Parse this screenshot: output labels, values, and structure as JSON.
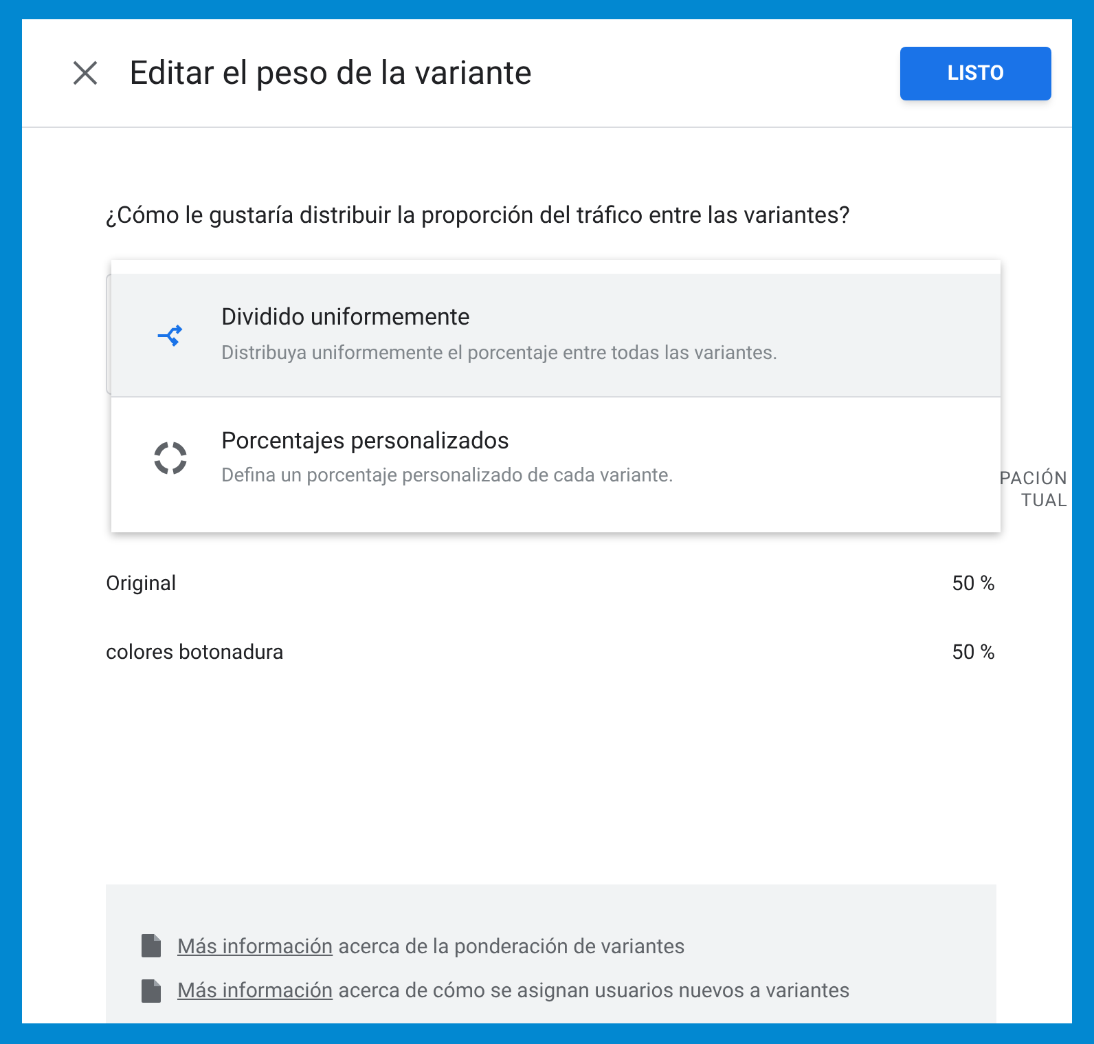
{
  "dialog": {
    "title": "Editar el peso de la variante",
    "done_button": "LISTO"
  },
  "question": "¿Cómo le gustaría distribuir la proporción del tráfico entre las variantes?",
  "menu": {
    "items": [
      {
        "kind": "split",
        "label": "Dividido uniformemente",
        "description": "Distribuya uniformemente el porcentaje entre todas las variantes.",
        "selected": true
      },
      {
        "kind": "custom",
        "label": "Porcentajes personalizados",
        "description": "Defina un porcentaje personalizado de cada variante.",
        "selected": false
      }
    ]
  },
  "table": {
    "columns": [
      "PACIÓN TUAL"
    ],
    "rows": [
      {
        "name": "Original",
        "share": "50 %"
      },
      {
        "name": "colores botonadura",
        "share": "50 %"
      }
    ]
  },
  "info": {
    "links": [
      {
        "link": "Más información",
        "text": "acerca de la ponderación de variantes"
      },
      {
        "link": "Más información",
        "text": "acerca de cómo se asignan usuarios nuevos a variantes"
      }
    ]
  }
}
